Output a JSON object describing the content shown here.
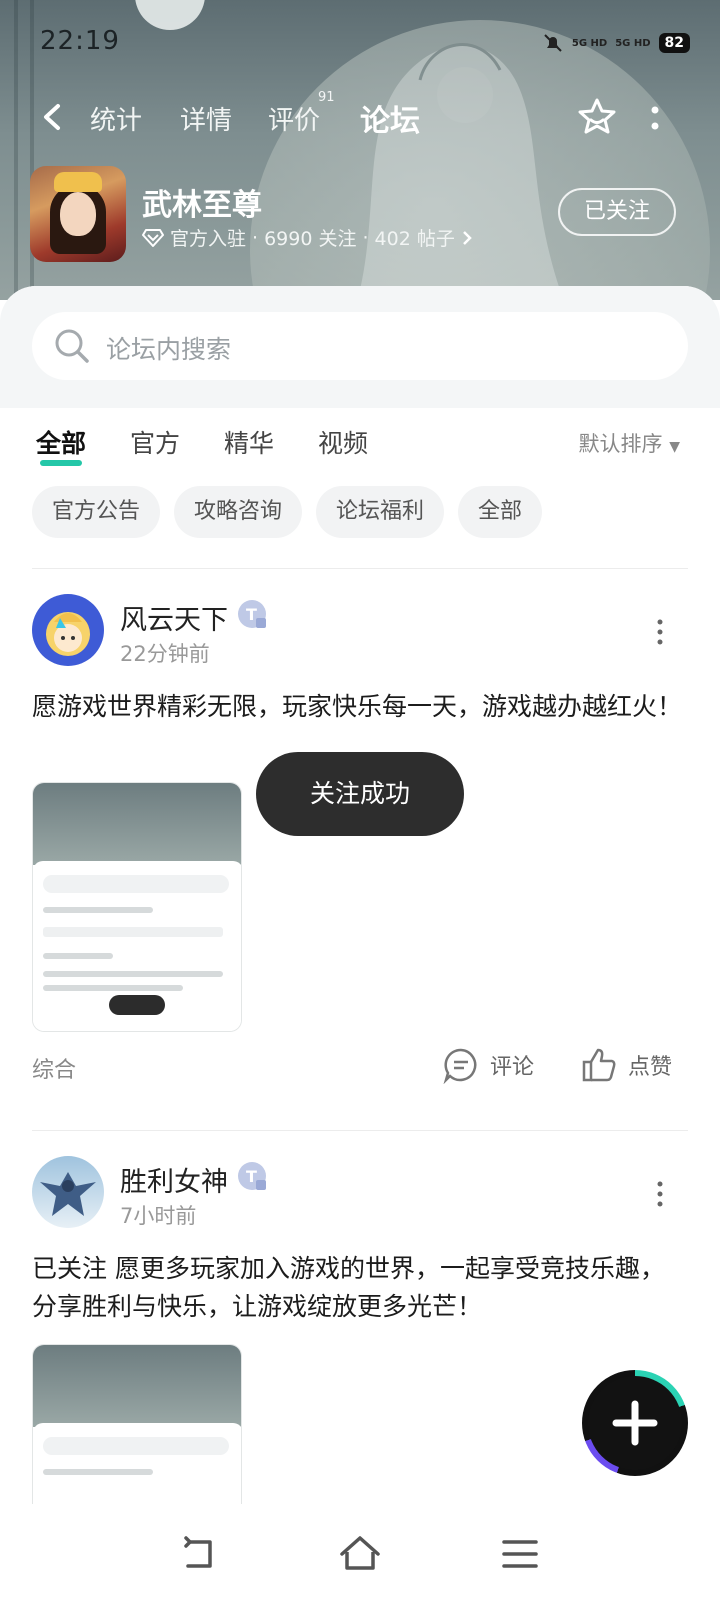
{
  "status_bar": {
    "time": "22:19",
    "signal_1": "5G HD",
    "signal_2": "5G HD",
    "battery": "82"
  },
  "top_nav": {
    "tabs": [
      {
        "label": "统计"
      },
      {
        "label": "详情"
      },
      {
        "label": "评价"
      },
      {
        "label": "论坛"
      }
    ],
    "review_count": "91",
    "active_tab": "论坛"
  },
  "app": {
    "title": "武林至尊",
    "official": "官方入驻",
    "followers": "6990 关注",
    "posts": "402 帖子",
    "separator": "·",
    "follow_label": "已关注"
  },
  "search": {
    "placeholder": "论坛内搜索"
  },
  "filter_tabs": {
    "items": [
      "全部",
      "官方",
      "精华",
      "视频"
    ],
    "sort_label": "默认排序"
  },
  "chips": [
    "官方公告",
    "攻略咨询",
    "论坛福利",
    "全部"
  ],
  "posts": [
    {
      "user": "风云天下",
      "time": "22分钟前",
      "text": "愿游戏世界精彩无限，玩家快乐每一天，游戏越办越红火！",
      "type": "综合",
      "comment_label": "评论",
      "like_label": "点赞"
    },
    {
      "user": "胜利女神",
      "time": "7小时前",
      "text": "已关注 愿更多玩家加入游戏的世界，一起享受竞技乐趣，分享胜利与快乐，让游戏绽放更多光芒！"
    }
  ],
  "toast": "关注成功",
  "colors": {
    "accent": "#24c7a8",
    "toast_bg": "#2d2d2d",
    "fab_teal": "#2bd3b4",
    "fab_purple": "#6b4cf0"
  },
  "icons": {
    "back": "chevron-left-icon",
    "favorite": "star-icon",
    "more": "more-vertical-icon",
    "search": "search-icon",
    "comment": "comment-icon",
    "like": "thumbs-up-icon",
    "fab": "plus-icon",
    "nav_back": "back-icon",
    "nav_home": "home-icon",
    "nav_menu": "menu-icon"
  }
}
